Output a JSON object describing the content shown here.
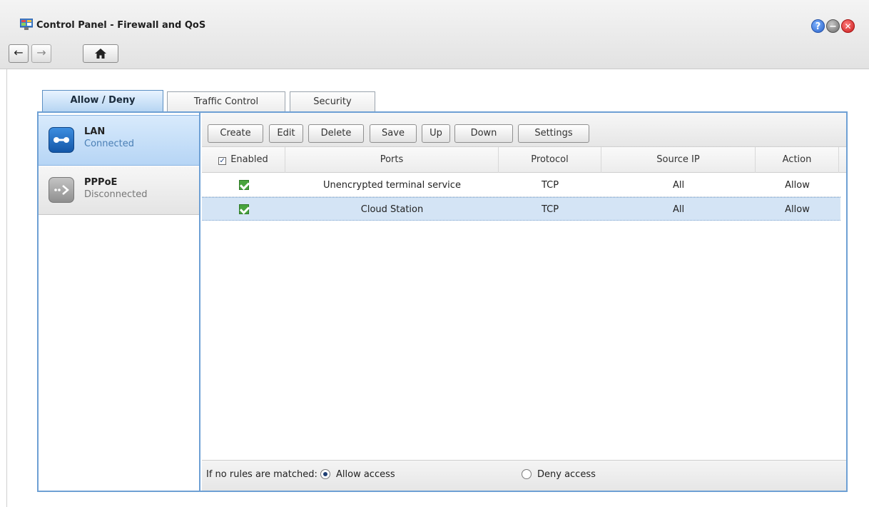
{
  "window": {
    "title": "Control Panel - Firewall and QoS"
  },
  "nav": {
    "back": "←",
    "forward": "→",
    "home": "🏠"
  },
  "window_buttons": {
    "help": "?",
    "minimize": "−",
    "close": "✕"
  },
  "tabs": [
    {
      "label": "Allow / Deny",
      "active": true
    },
    {
      "label": "Traffic Control",
      "active": false
    },
    {
      "label": "Security",
      "active": false
    }
  ],
  "interfaces": [
    {
      "name": "LAN",
      "status": "Connected",
      "icon": "lan-connected-icon",
      "selected": true
    },
    {
      "name": "PPPoE",
      "status": "Disconnected",
      "icon": "pppoe-disconnected-icon",
      "selected": false
    }
  ],
  "toolbar": {
    "create": "Create",
    "edit": "Edit",
    "delete": "Delete",
    "save": "Save",
    "up": "Up",
    "down": "Down",
    "settings": "Settings"
  },
  "table": {
    "columns": {
      "enabled": "Enabled",
      "ports": "Ports",
      "protocol": "Protocol",
      "source_ip": "Source IP",
      "action": "Action"
    },
    "rows": [
      {
        "enabled": true,
        "ports": "Unencrypted terminal service",
        "protocol": "TCP",
        "source_ip": "All",
        "action": "Allow",
        "selected": false
      },
      {
        "enabled": true,
        "ports": "Cloud Station",
        "protocol": "TCP",
        "source_ip": "All",
        "action": "Allow",
        "selected": true
      }
    ]
  },
  "footer": {
    "label": "If no rules are matched:",
    "allow": "Allow access",
    "deny": "Deny access",
    "selected": "allow"
  },
  "colors": {
    "accent": "#6ea0d4",
    "selected_row": "#d4e4f5",
    "check_green": "#49a43e"
  }
}
